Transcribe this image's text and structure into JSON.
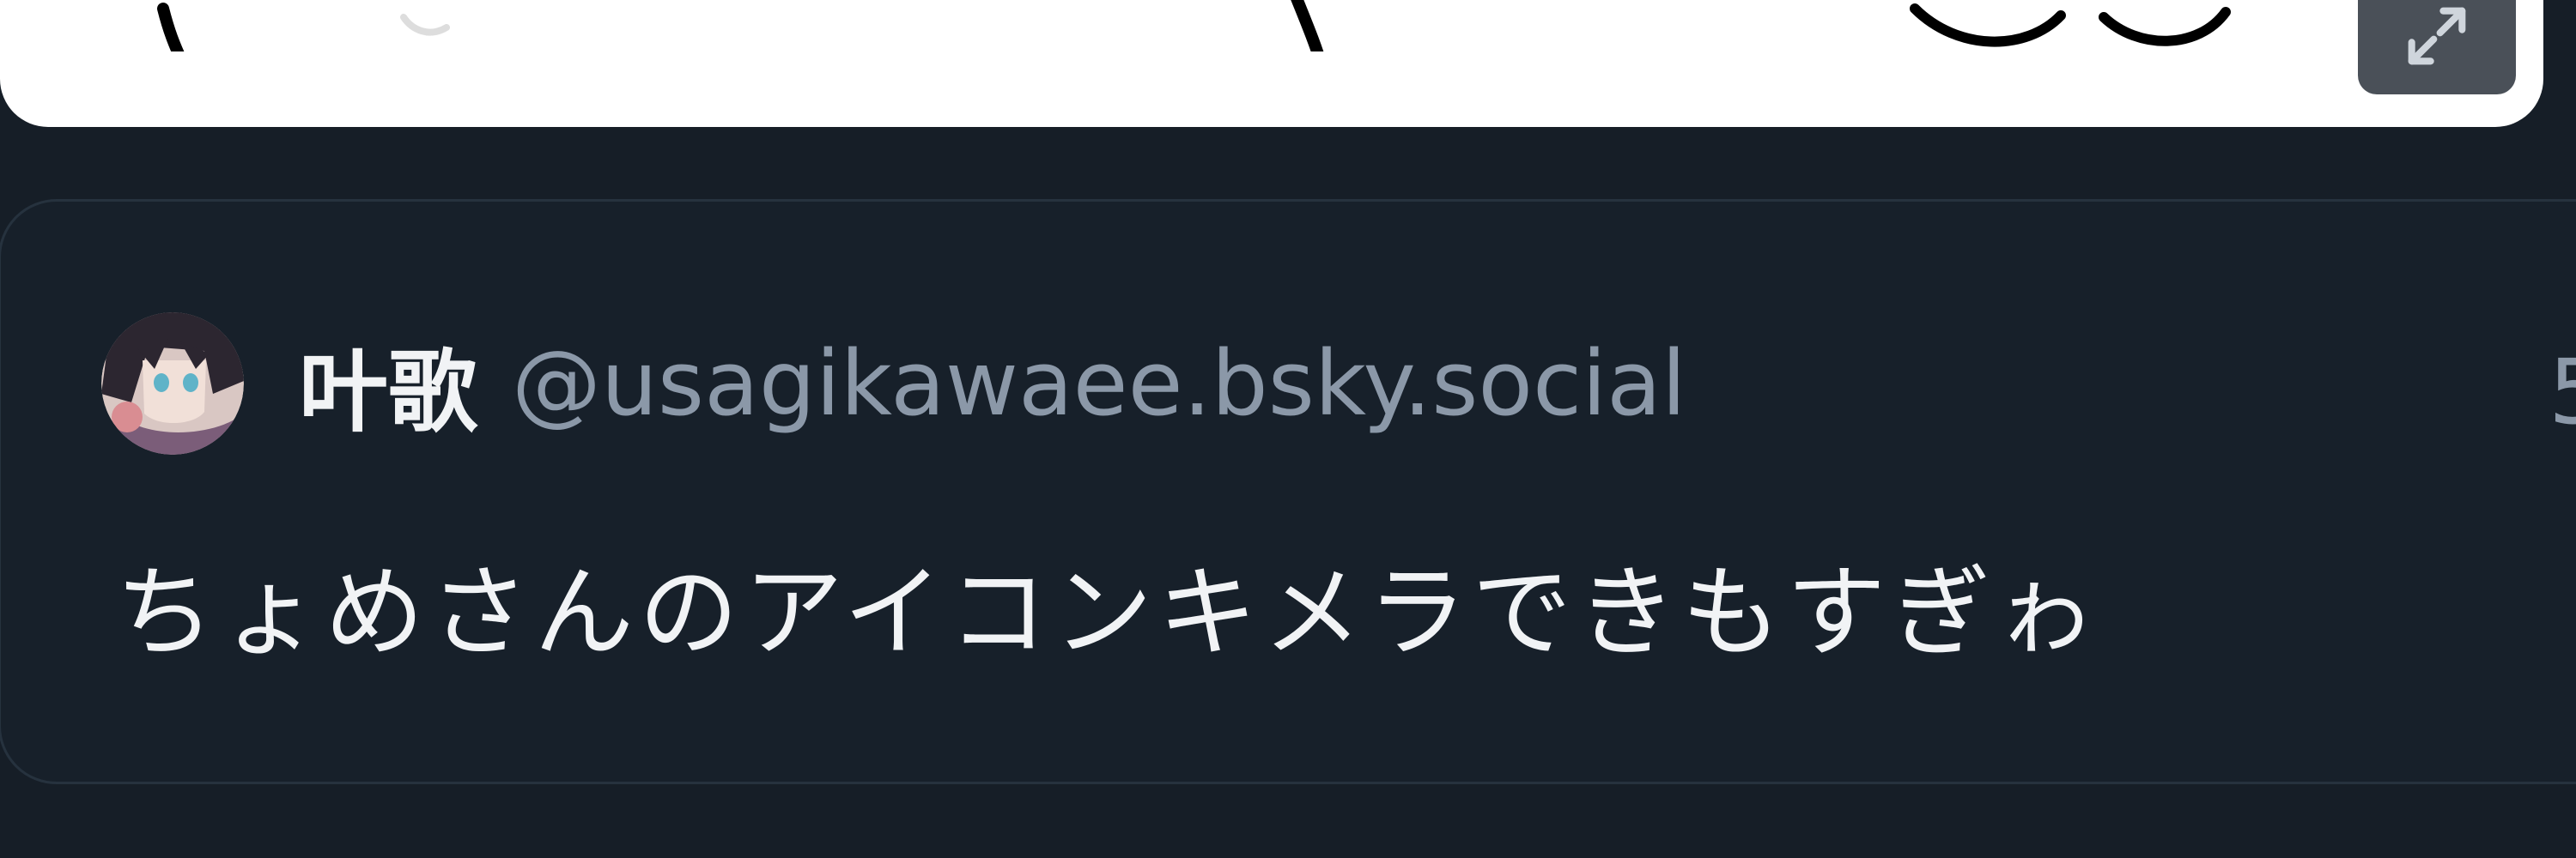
{
  "media": {
    "expand_icon": "expand-arrows-icon"
  },
  "quote": {
    "avatar_icon": "avatar-image",
    "display_name": "叶歌",
    "handle": "@usagikawaee.bsky.social",
    "timestamp": "5",
    "text": "ちょめさんのアイコンキメラできもすぎゎ"
  },
  "colors": {
    "background": "#161e27",
    "card_border": "#26323e",
    "primary_text": "#f1f3f5",
    "secondary_text": "#8b98a8",
    "expand_button": "#4a5058"
  }
}
